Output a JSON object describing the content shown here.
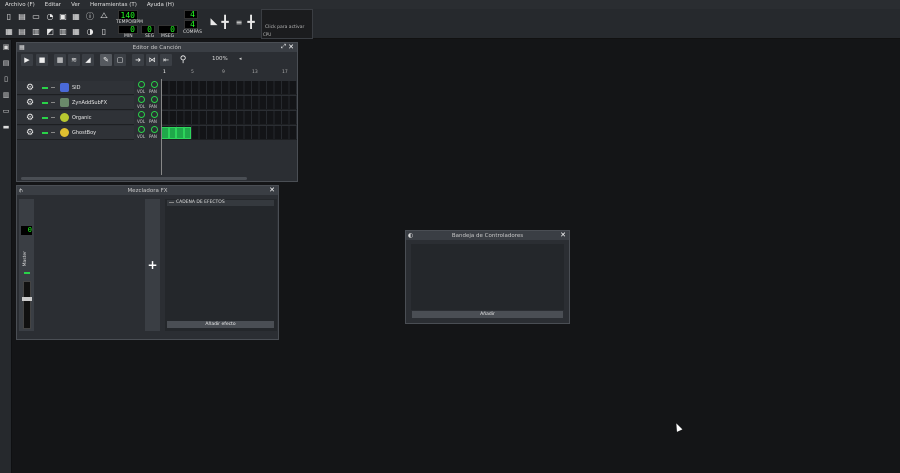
{
  "menubar": {
    "items": [
      "Archivo (F)",
      "Editar",
      "Ver",
      "Herramientas (T)",
      "Ayuda (H)"
    ]
  },
  "toolbar": {
    "tempo_value": "140",
    "tempo_label": "TEMPO/BPM",
    "time_min": "0",
    "time_sec": "0",
    "time_msec": "0",
    "min_label": "MIN",
    "sec_label": "SEG",
    "msec_label": "MSEG",
    "sig_num": "4",
    "sig_den": "4",
    "sig_label": "COMPÁS",
    "cpu_click_text": "Click para activar",
    "cpu_label": "CPU"
  },
  "song_editor": {
    "title": "Editor de Canción",
    "zoom": "100%",
    "ruler": [
      "1",
      "5",
      "9",
      "13",
      "17"
    ],
    "tracks": [
      {
        "name": "SID",
        "icon_color": "#4a6ad8",
        "vol": "VOL",
        "pan": "PAN"
      },
      {
        "name": "ZynAddSubFX",
        "icon_color": "#6a8a6a",
        "vol": "VOL",
        "pan": "PAN"
      },
      {
        "name": "Organic",
        "icon_color": "#b8c830",
        "vol": "VOL",
        "pan": "PAN"
      },
      {
        "name": "GhostBoy",
        "icon_color": "#e0c030",
        "vol": "VOL",
        "pan": "PAN"
      }
    ]
  },
  "mixer": {
    "title": "Mezcladora FX",
    "master_value": "0",
    "master_label": "Master",
    "add_channel_symbol": "+",
    "effects_chain_header": "CADENA DE EFECTOS",
    "add_effect_label": "Añadir efecto"
  },
  "controller_rack": {
    "title": "Bandeja de Controladores",
    "add_label": "Añadir"
  }
}
